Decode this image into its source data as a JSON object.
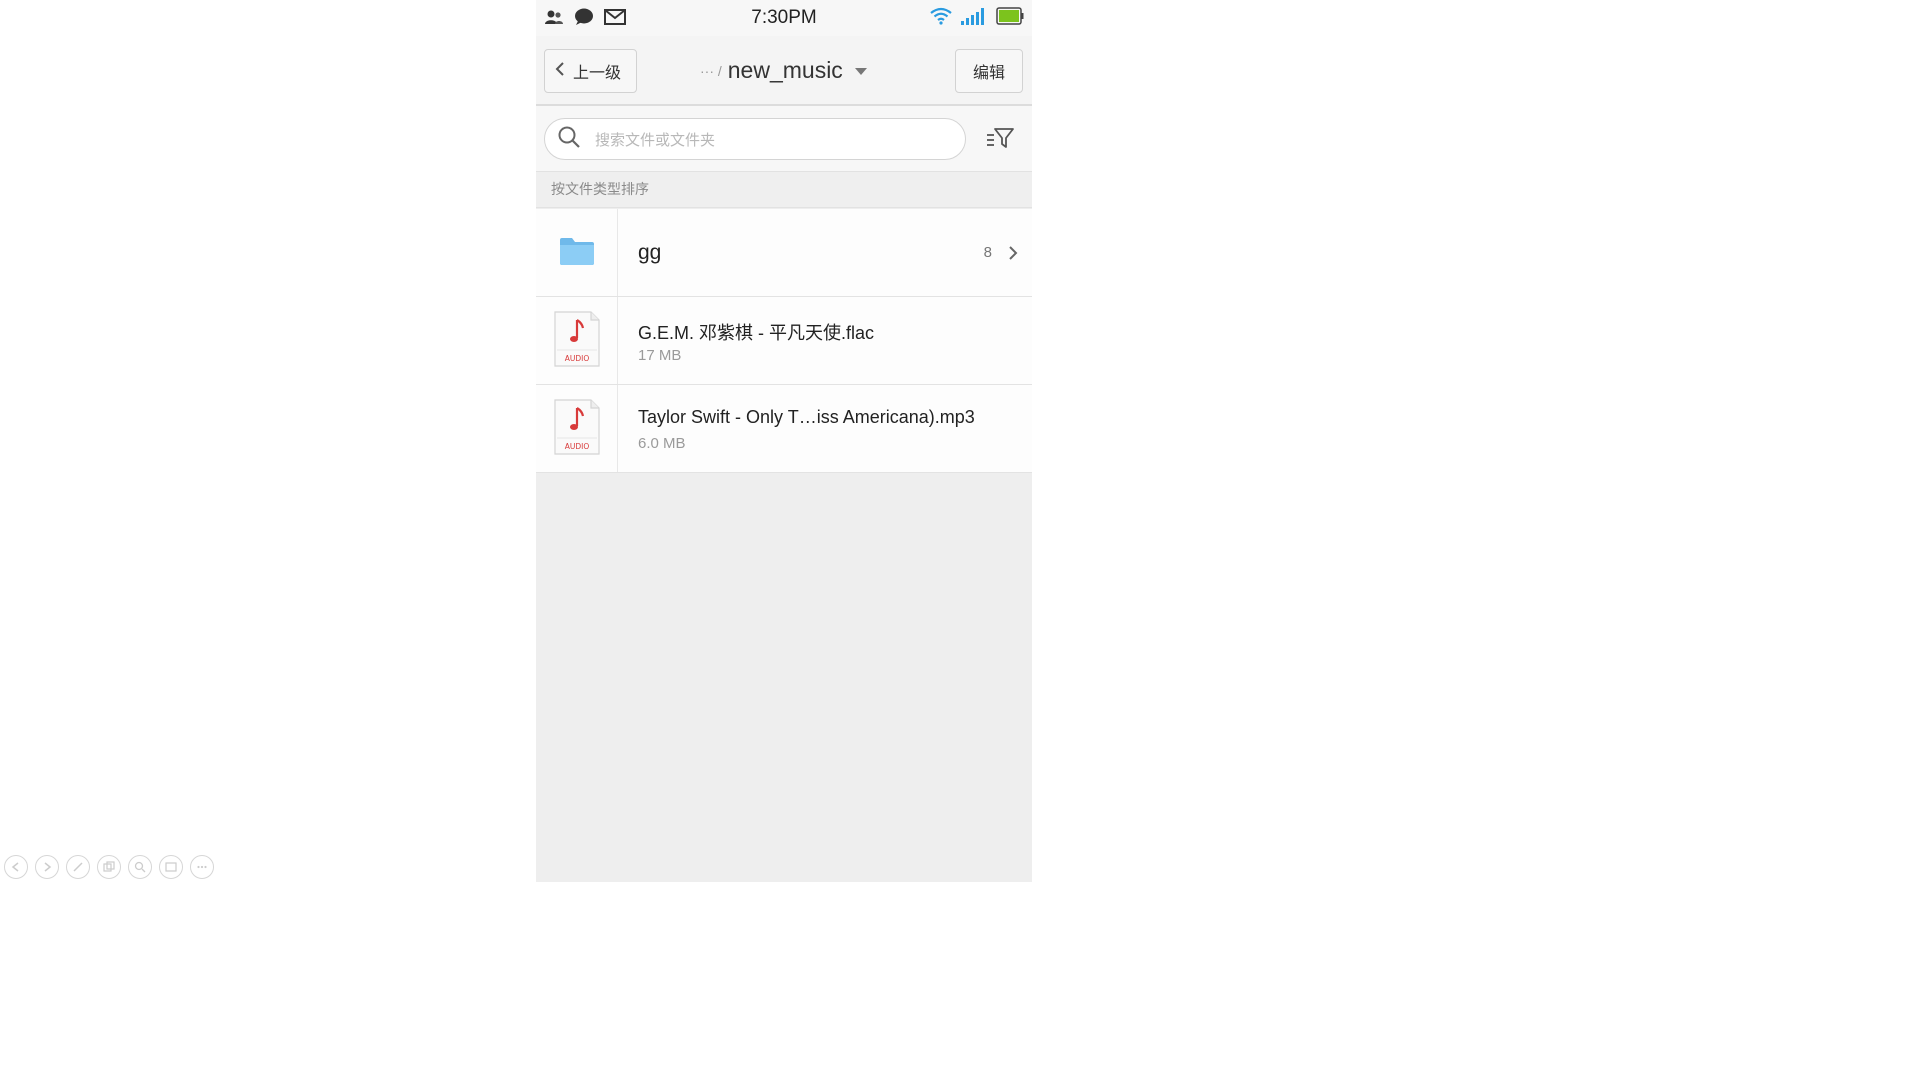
{
  "status_bar": {
    "time": "7:30PM",
    "left_icons": [
      "contacts-icon",
      "chat-bubble-icon",
      "mail-icon"
    ],
    "right_icons": [
      "wifi-icon",
      "signal-icon",
      "battery-icon"
    ],
    "battery_color": "#7cc31d"
  },
  "top_bar": {
    "back_label": "上一级",
    "path_ellipsis": "··· /",
    "folder_name": "new_music",
    "edit_label": "编辑"
  },
  "search": {
    "placeholder": "搜索文件或文件夹"
  },
  "sort_label": "按文件类型排序",
  "files": [
    {
      "type": "folder",
      "name": "gg",
      "count": "8"
    },
    {
      "type": "audio",
      "name": "G.E.M. 邓紫棋 - 平凡天使.flac",
      "size": "17 MB",
      "badge": "AUDIO"
    },
    {
      "type": "audio",
      "name": "Taylor Swift - Only T…iss Americana).mp3",
      "size": "6.0 MB",
      "badge": "AUDIO"
    }
  ],
  "colors": {
    "folder": "#7cc4f2",
    "audio_note": "#d83a3a",
    "audio_badge": "#d83a3a"
  },
  "bottom_controls": [
    "prev-icon",
    "play-icon",
    "pen-icon",
    "copy-icon",
    "zoom-icon",
    "screen-icon",
    "more-icon"
  ]
}
